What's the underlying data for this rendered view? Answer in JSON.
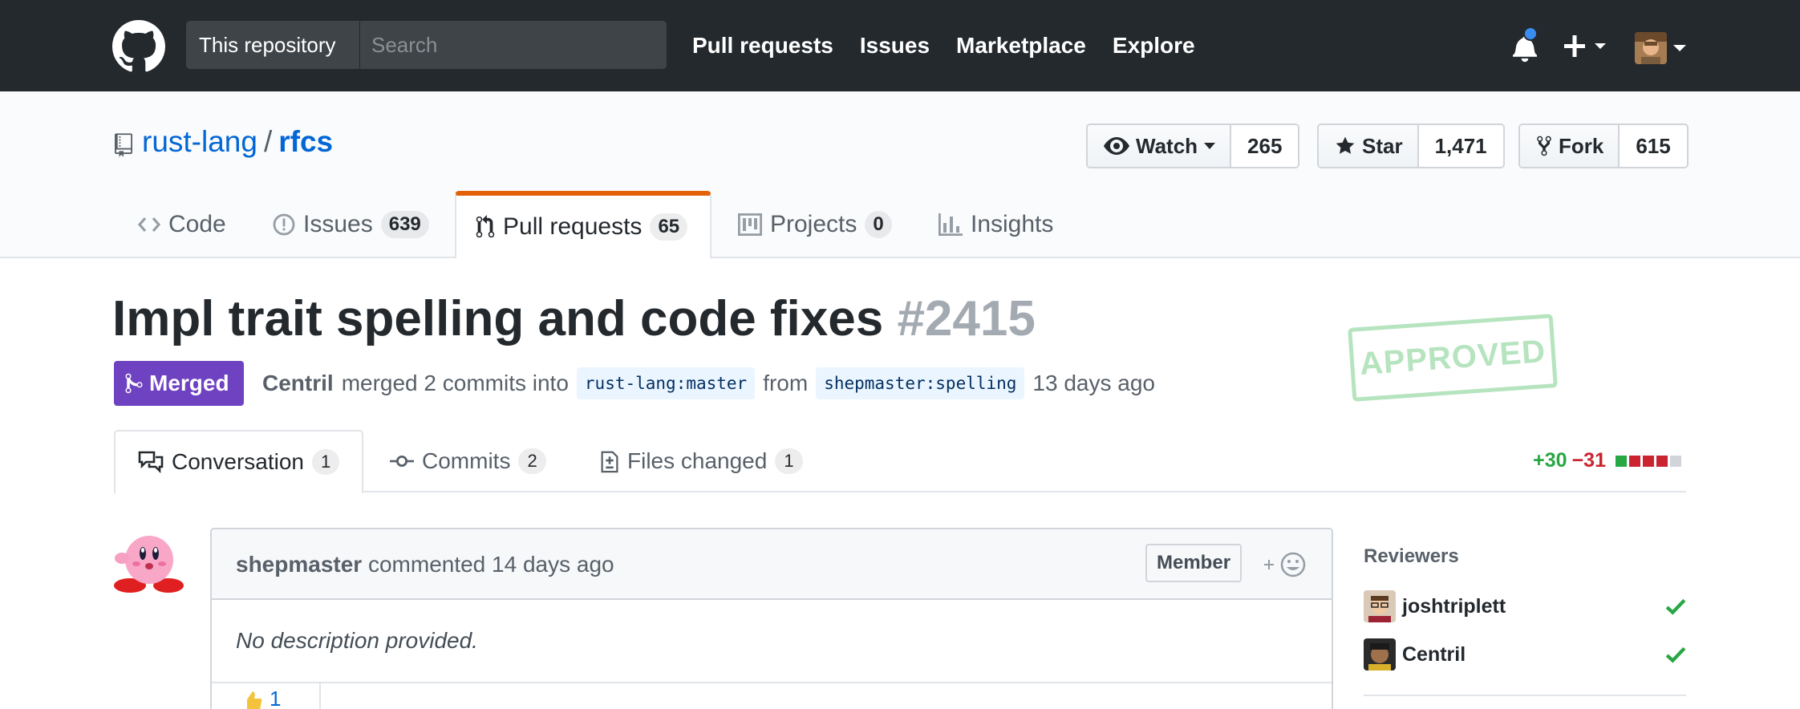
{
  "header": {
    "scope_label": "This repository",
    "search_placeholder": "Search",
    "nav": [
      "Pull requests",
      "Issues",
      "Marketplace",
      "Explore"
    ],
    "icons": [
      "github-logo",
      "bell-icon",
      "plus-icon",
      "avatar"
    ],
    "colors": {
      "bar": "#24292e",
      "notification": "#3a8cf0"
    }
  },
  "repo": {
    "owner": "rust-lang",
    "separator": "/",
    "name": "rfcs",
    "watch": {
      "label": "Watch",
      "count": "265"
    },
    "star": {
      "label": "Star",
      "count": "1,471"
    },
    "fork": {
      "label": "Fork",
      "count": "615"
    },
    "tabs": [
      {
        "label": "Code",
        "count": null,
        "icon": "code-icon"
      },
      {
        "label": "Issues",
        "count": "639",
        "icon": "issue-icon"
      },
      {
        "label": "Pull requests",
        "count": "65",
        "icon": "pull-request-icon",
        "selected": true
      },
      {
        "label": "Projects",
        "count": "0",
        "icon": "project-icon"
      },
      {
        "label": "Insights",
        "count": null,
        "icon": "graph-icon"
      }
    ],
    "selected_tab_color": "#e36209"
  },
  "pr": {
    "title": "Impl trait spelling and code fixes",
    "number": "#2415",
    "status": "Merged",
    "status_color": "#6f42c1",
    "author": "Centril",
    "meta_mid": "merged 2 commits into",
    "base_branch": "rust-lang:master",
    "meta_from": "from",
    "head_branch": "shepmaster:spelling",
    "time": "13 days ago",
    "stamp": "APPROVED",
    "stamp_color": "#b6e4bf"
  },
  "pr_tabs": [
    {
      "label": "Conversation",
      "count": "1",
      "icon": "comment-discussion-icon",
      "selected": true
    },
    {
      "label": "Commits",
      "count": "2",
      "icon": "commit-icon"
    },
    {
      "label": "Files changed",
      "count": "1",
      "icon": "file-diff-icon"
    }
  ],
  "diffstat": {
    "additions": "+30",
    "deletions": "−31",
    "blocks": [
      "#28a745",
      "#cb2431",
      "#cb2431",
      "#cb2431",
      "#d1d5da"
    ]
  },
  "comment": {
    "author": "shepmaster",
    "action": "commented",
    "time": "14 days ago",
    "role": "Member",
    "body": "No description provided.",
    "reaction_count": "1"
  },
  "sidebar": {
    "title": "Reviewers",
    "reviewers": [
      {
        "name": "joshtriplett",
        "status": "approved"
      },
      {
        "name": "Centril",
        "status": "approved"
      }
    ],
    "approved_color": "#28a745"
  }
}
